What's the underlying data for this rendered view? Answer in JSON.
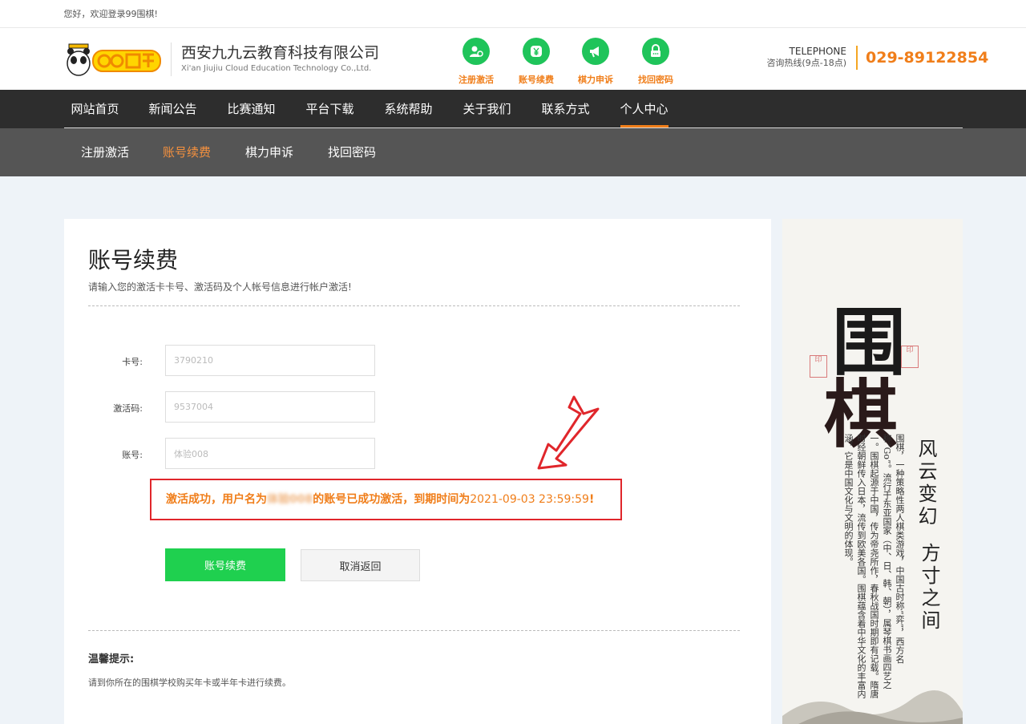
{
  "topbar": {
    "welcome": "您好，欢迎登录99围棋!"
  },
  "header": {
    "company_cn": "西安九九云教育科技有限公司",
    "company_en": "Xi'an Jiujiu Cloud Education Technology Co.,Ltd.",
    "quick_links": [
      {
        "label": "注册激活",
        "icon": "user-add-icon"
      },
      {
        "label": "账号续费",
        "icon": "yuan-coin-icon"
      },
      {
        "label": "棋力申诉",
        "icon": "megaphone-icon"
      },
      {
        "label": "找回密码",
        "icon": "lock-icon"
      }
    ],
    "telephone_label": "TELEPHONE",
    "hotline_label": "咨询热线(9点-18点)",
    "phone": "029-89122854"
  },
  "main_nav": [
    "网站首页",
    "新闻公告",
    "比赛通知",
    "平台下载",
    "系统帮助",
    "关于我们",
    "联系方式",
    "个人中心"
  ],
  "main_nav_active": "个人中心",
  "sub_nav": [
    "注册激活",
    "账号续费",
    "棋力申诉",
    "找回密码"
  ],
  "sub_nav_active": "账号续费",
  "form": {
    "title": "账号续费",
    "subtitle": "请输入您的激活卡卡号、激活码及个人帐号信息进行帐户激活!",
    "card_label": "卡号:",
    "card_value": "3790210",
    "code_label": "激活码:",
    "code_value": "9537004",
    "account_label": "账号:",
    "account_value": "体验008",
    "message_prefix": "激活成功，用户名为",
    "message_username": "体验008",
    "message_middle": "的账号已成功激活，到期时间为",
    "message_time": "2021-09-03 23:59:59",
    "message_suffix": "!",
    "renew_button": "账号续费",
    "cancel_button": "取消返回"
  },
  "tips": {
    "title": "温馨提示:",
    "text": "请到你所在的围棋学校购买年卡或半年卡进行续费。"
  },
  "banner": {
    "char1": "围",
    "char2": "棋",
    "poem1": "风云变幻",
    "poem2": "方寸之间",
    "description": "围棋，一种策略性两人棋类游戏，中国古时称“弈”，西方名称“Go”。流行于东亚国家（中、日、韩、朝），属琴棋书画四艺之一。围棋起源于中国，传为帝尧所作，春秋战国时期即有记载。隋唐时经朝鲜传入日本，流传到欧美各国。围棋蕴含着中华文化的丰富内涵，它是中国文化与文明的体现。"
  },
  "colors": {
    "accent": "#f07e1a",
    "green": "#1fd04f",
    "nav_bg": "#2d2d2d",
    "subnav_bg": "#555555",
    "alert": "#e0262b"
  }
}
